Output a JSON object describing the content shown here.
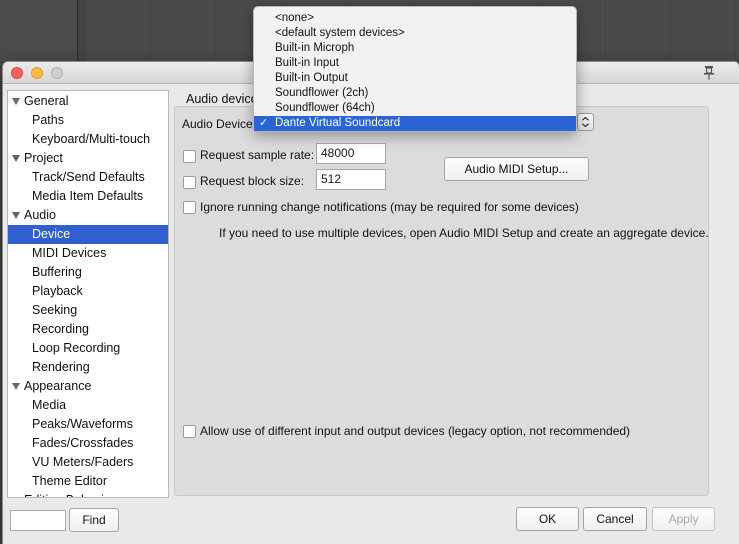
{
  "window": {
    "section_title": "Audio device",
    "pin_icon": "pin-icon"
  },
  "sidebar": {
    "items": [
      {
        "label": "General",
        "level": "category"
      },
      {
        "label": "Paths",
        "level": "item"
      },
      {
        "label": "Keyboard/Multi-touch",
        "level": "item"
      },
      {
        "label": "Project",
        "level": "category"
      },
      {
        "label": "Track/Send Defaults",
        "level": "item"
      },
      {
        "label": "Media Item Defaults",
        "level": "item"
      },
      {
        "label": "Audio",
        "level": "category"
      },
      {
        "label": "Device",
        "level": "item",
        "selected": true
      },
      {
        "label": "MIDI Devices",
        "level": "item"
      },
      {
        "label": "Buffering",
        "level": "item"
      },
      {
        "label": "Playback",
        "level": "item"
      },
      {
        "label": "Seeking",
        "level": "item"
      },
      {
        "label": "Recording",
        "level": "item"
      },
      {
        "label": "Loop Recording",
        "level": "item"
      },
      {
        "label": "Rendering",
        "level": "item"
      },
      {
        "label": "Appearance",
        "level": "category"
      },
      {
        "label": "Media",
        "level": "item"
      },
      {
        "label": "Peaks/Waveforms",
        "level": "item"
      },
      {
        "label": "Fades/Crossfades",
        "level": "item"
      },
      {
        "label": "VU Meters/Faders",
        "level": "item"
      },
      {
        "label": "Theme Editor",
        "level": "item"
      },
      {
        "label": "Editing Behavior",
        "level": "category"
      }
    ]
  },
  "find": {
    "input_value": "",
    "button_label": "Find"
  },
  "audio": {
    "device_label": "Audio Device:",
    "request_sample_rate_label": "Request sample rate:",
    "request_sample_rate_value": "48000",
    "request_block_size_label": "Request block size:",
    "request_block_size_value": "512",
    "midi_setup_button": "Audio MIDI Setup...",
    "ignore_changes_label": "Ignore running change notifications (may be required for some devices)",
    "hint_text": "If you need to use multiple devices, open Audio MIDI Setup and create an aggregate device.",
    "allow_different_label": "Allow use of different input and output devices (legacy option, not recommended)"
  },
  "dropdown": {
    "options": [
      "<none>",
      "<default system devices>",
      "Built-in Microph",
      "Built-in Input",
      "Built-in Output",
      "Soundflower (2ch)",
      "Soundflower (64ch)",
      "Dante Virtual Soundcard"
    ],
    "selected_index": 7,
    "check_glyph": "✓"
  },
  "buttons": {
    "ok": "OK",
    "cancel": "Cancel",
    "apply": "Apply"
  },
  "colors": {
    "selection": "#2f5fd0",
    "menu_highlight": "#2b63d8"
  }
}
